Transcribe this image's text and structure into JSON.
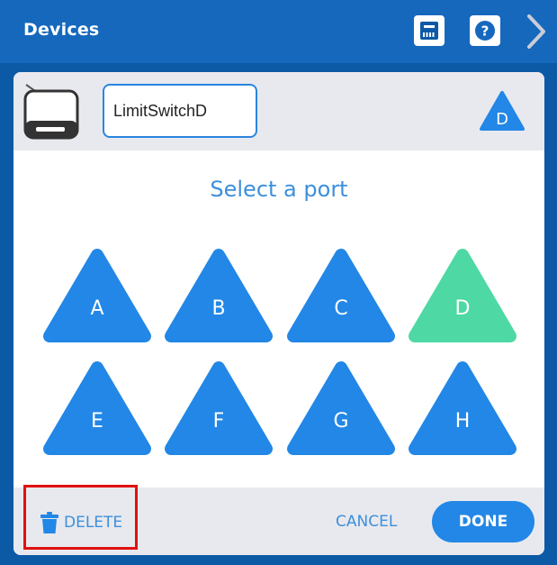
{
  "header": {
    "title": "Devices",
    "icons": [
      "ethernet-icon",
      "help-icon",
      "chevron-right-icon"
    ]
  },
  "device": {
    "name_value": "LimitSwitchD",
    "port_badge": "D",
    "icon": "limit-switch-device-icon"
  },
  "main": {
    "title": "Select a port",
    "ports": [
      {
        "label": "A",
        "selected": false
      },
      {
        "label": "B",
        "selected": false
      },
      {
        "label": "C",
        "selected": false
      },
      {
        "label": "D",
        "selected": true
      },
      {
        "label": "E",
        "selected": false
      },
      {
        "label": "F",
        "selected": false
      },
      {
        "label": "G",
        "selected": false
      },
      {
        "label": "H",
        "selected": false
      }
    ]
  },
  "footer": {
    "delete_label": "DELETE",
    "cancel_label": "CANCEL",
    "done_label": "DONE"
  },
  "colors": {
    "header_bg": "#1668bd",
    "port_default": "#2287e6",
    "port_selected": "#4ed8a4",
    "accent_text": "#3d8fdc",
    "highlight": "#e01010"
  }
}
